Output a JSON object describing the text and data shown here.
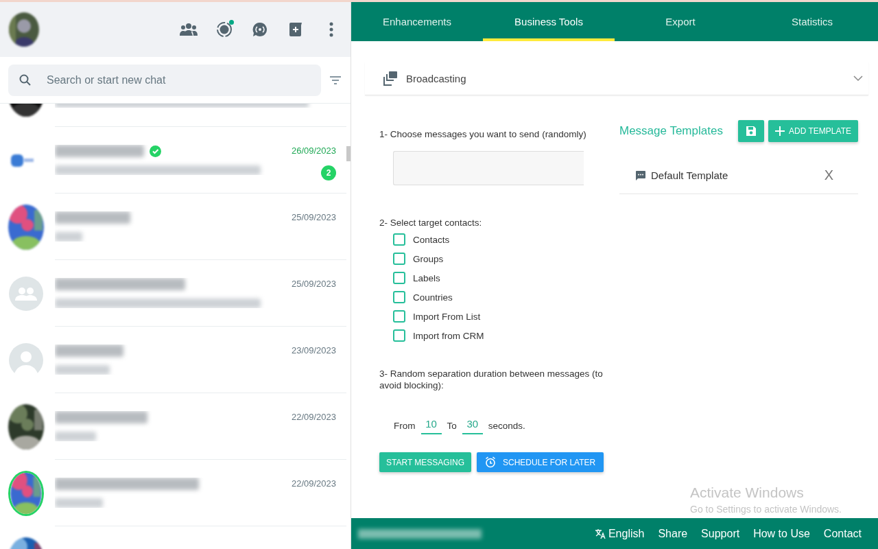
{
  "sidebar": {
    "header": {
      "icons": [
        {
          "kind": "community"
        },
        {
          "kind": "status",
          "has_update": true
        },
        {
          "kind": "channels"
        },
        {
          "kind": "new_chat"
        },
        {
          "kind": "menu"
        }
      ]
    },
    "search": {
      "placeholder": "Search or start new chat"
    },
    "top_partial_chat": {
      "avatar": {
        "kind": "dark"
      }
    },
    "chats": [
      {
        "avatar": {
          "kind": "logo"
        },
        "verified": true,
        "status_ring": false,
        "date": "26/09/2023",
        "unread": "2"
      },
      {
        "verified": false,
        "status_ring": false,
        "date": "25/09/2023"
      },
      {
        "avatar": {
          "kind": "group"
        },
        "verified": false,
        "status_ring": false,
        "date": "25/09/2023"
      },
      {
        "avatar": {
          "kind": "person"
        },
        "verified": false,
        "status_ring": false,
        "date": "23/09/2023"
      },
      {
        "verified": false,
        "status_ring": false,
        "date": "22/09/2023"
      },
      {
        "verified": false,
        "status_ring": true,
        "date": "22/09/2023"
      },
      {
        "verified": false,
        "status_ring": false
      }
    ]
  },
  "tabs": [
    {
      "label": "Enhancements",
      "selected": false
    },
    {
      "label": "Business Tools",
      "selected": true
    },
    {
      "label": "Export",
      "selected": false
    },
    {
      "label": "Statistics",
      "selected": false
    }
  ],
  "section": {
    "title": "Broadcasting",
    "expanded": true
  },
  "broadcast": {
    "step1": "1- Choose messages you want to send (randomly)",
    "step2": "2- Select target contacts:",
    "contacts": [
      {
        "label": "Contacts",
        "checked": false
      },
      {
        "label": "Groups",
        "checked": false
      },
      {
        "label": "Labels",
        "checked": false
      },
      {
        "label": "Countries",
        "checked": false
      },
      {
        "label": "Import From List",
        "checked": false
      },
      {
        "label": "Import from CRM",
        "checked": false
      }
    ],
    "step3": "3- Random separation duration between messages (to avoid blocking):",
    "from_label": "From",
    "from_value": "10",
    "to_label": "To",
    "to_value": "30",
    "unit": "seconds.",
    "buttons": [
      {
        "kind": "start",
        "label": "START MESSAGING"
      },
      {
        "kind": "schedule",
        "label": "SCHEDULE FOR LATER"
      }
    ]
  },
  "templates": {
    "title": "Message Templates",
    "add_label": "ADD TEMPLATE",
    "items": [
      {
        "label": "Default Template",
        "remove": "X"
      }
    ]
  },
  "os_notice": {
    "title": "Activate Windows",
    "text": "Go to Settings to activate Windows."
  },
  "footer": {
    "language": "English",
    "links": [
      "Share",
      "Support",
      "How to Use",
      "Contact"
    ]
  }
}
